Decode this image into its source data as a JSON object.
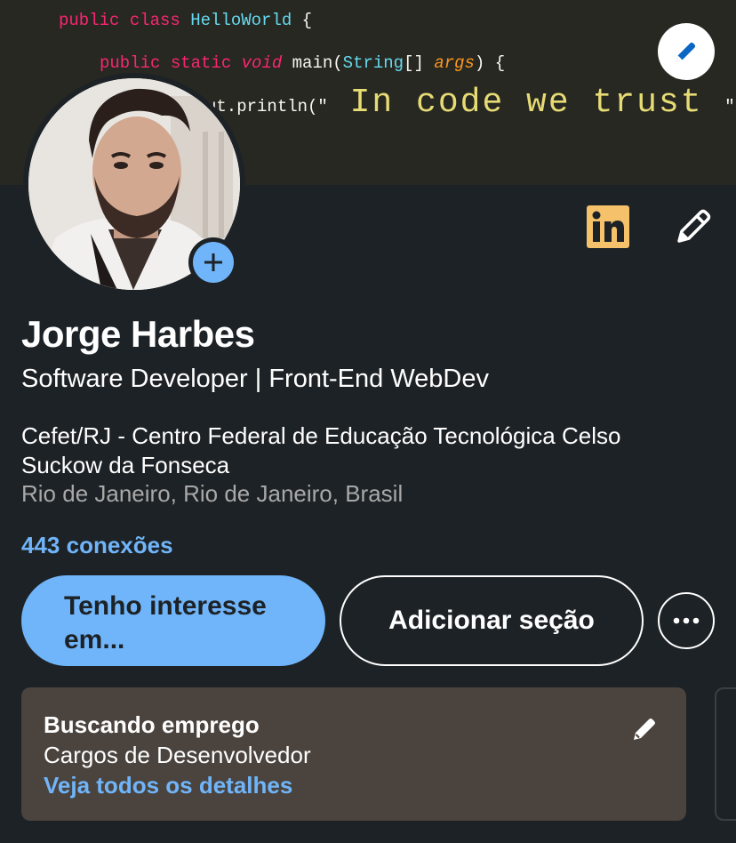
{
  "banner": {
    "code_line1": {
      "kw": "public class ",
      "cls": "HelloWorld",
      "rest": " {"
    },
    "code_line2": {
      "kw": "public static ",
      "it": "void",
      "fn": " main(",
      "type": "String",
      "mid": "[] ",
      "arg": "args",
      "rest": ") {"
    },
    "code_line3": {
      "pre": "ut.println(\"",
      "big": " In code we trust ",
      "post": "\");"
    },
    "edit_icon": "pencil-icon"
  },
  "profile": {
    "name": "Jorge Harbes",
    "headline": "Software Developer | Front-End WebDev",
    "education": "Cefet/RJ - Centro Federal de Educação Tecnológica Celso Suckow da Fonseca",
    "location": "Rio de Janeiro, Rio de Janeiro, Brasil",
    "connections": "443 conexões",
    "add_photo_icon": "plus-icon",
    "linkedin_icon": "linkedin-icon",
    "edit_icon": "pencil-icon"
  },
  "actions": {
    "primary_label": "Tenho interesse em...",
    "secondary_label": "Adicionar seção",
    "more_icon": "more-horizontal-icon"
  },
  "open_to_work": {
    "title": "Buscando emprego",
    "subtitle": "Cargos de Desenvolvedor",
    "link": "Veja todos os detalhes",
    "edit_icon": "pencil-icon"
  },
  "colors": {
    "background": "#1d2226",
    "accent": "#70b5f9",
    "linkedin_logo": "#f5c26b",
    "card": "#4a433e"
  }
}
